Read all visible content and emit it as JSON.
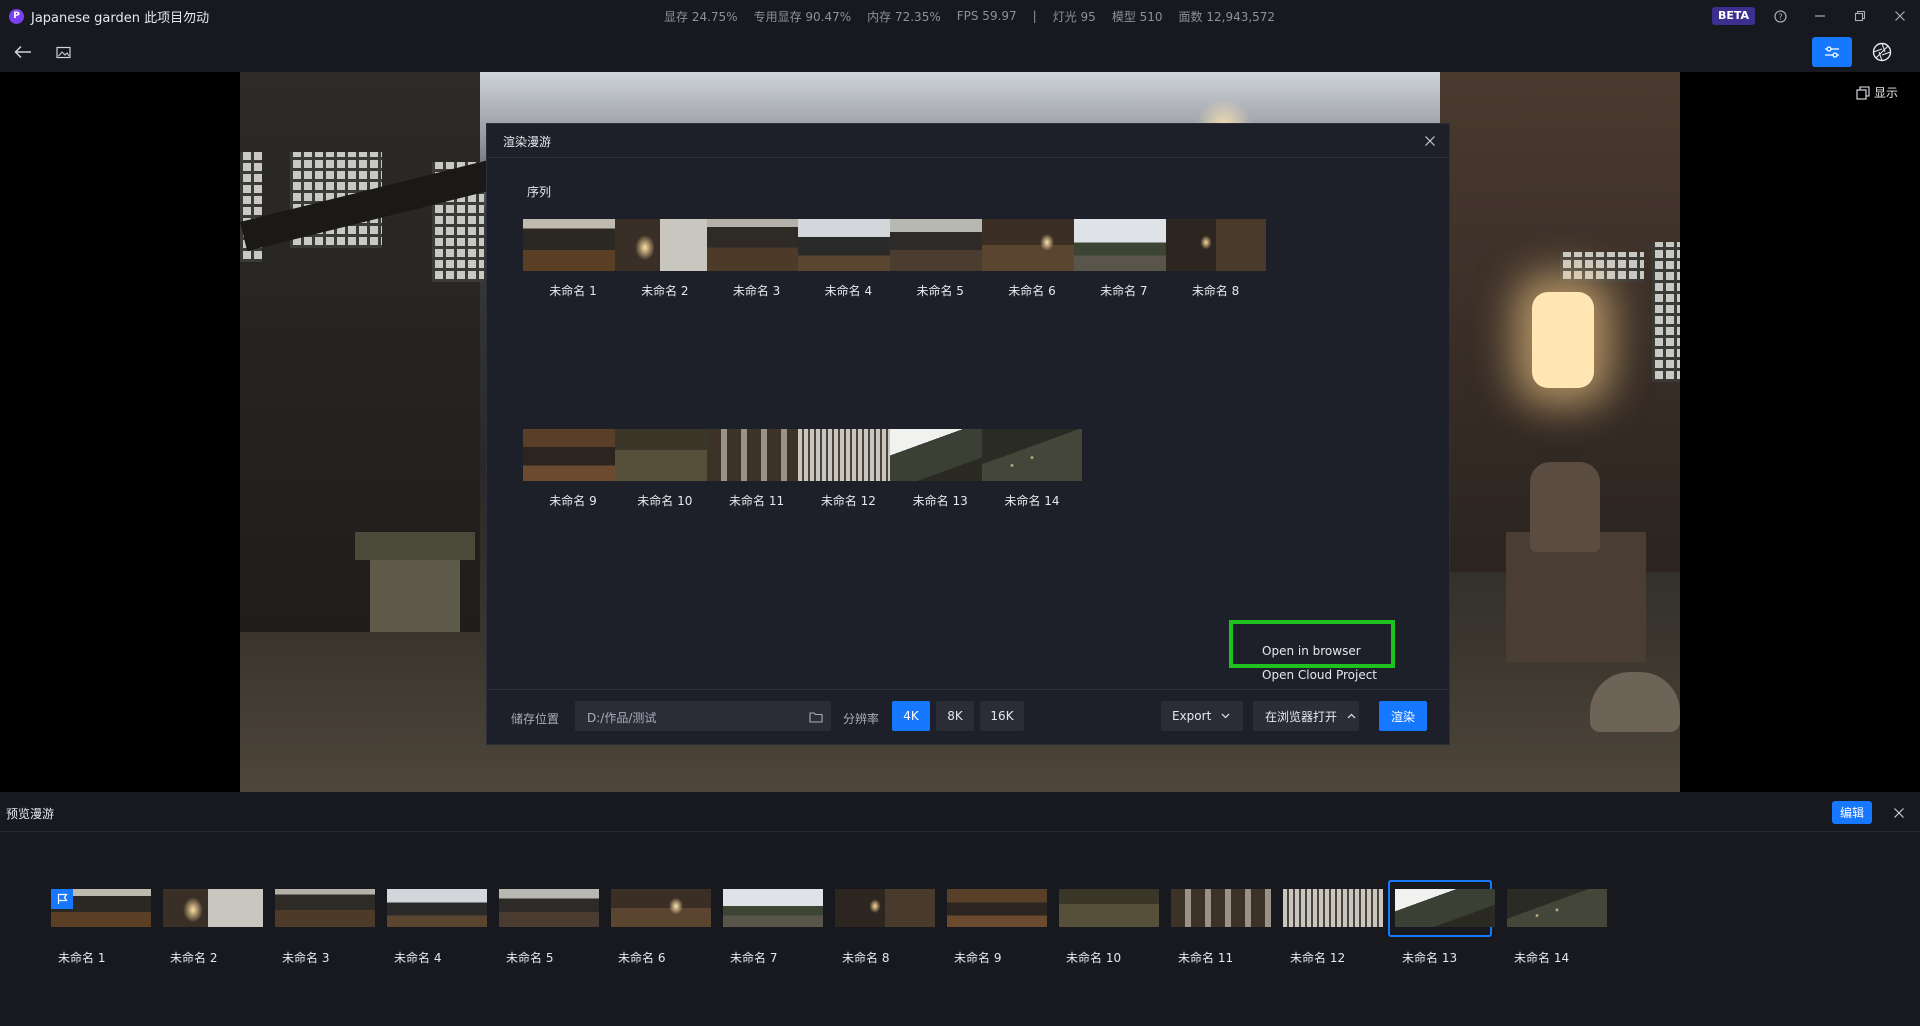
{
  "app": {
    "logo_letter": "P",
    "project_name": "Japanese garden 此项目勿动"
  },
  "stats": {
    "vram": "显存 24.75%",
    "dedicated_vram": "专用显存 90.47%",
    "memory": "内存 72.35%",
    "fps": "FPS 59.97",
    "separator": "|",
    "lights": "灯光 95",
    "models": "模型 510",
    "faces": "面数 12,943,572"
  },
  "title_bar": {
    "beta_label": "BETA",
    "icons": [
      "help-icon",
      "minimize-icon",
      "restore-icon",
      "close-icon"
    ]
  },
  "toolbar": {
    "icons": [
      "back-arrow-icon",
      "image-icon",
      "sliders-icon",
      "aperture-icon"
    ]
  },
  "viewport": {
    "display_label": "显示"
  },
  "render_dialog": {
    "title": "渲染漫游",
    "section_label": "序列",
    "sequences": [
      {
        "name": "未命名 1"
      },
      {
        "name": "未命名 2"
      },
      {
        "name": "未命名 3"
      },
      {
        "name": "未命名 4"
      },
      {
        "name": "未命名 5"
      },
      {
        "name": "未命名 6"
      },
      {
        "name": "未命名 7"
      },
      {
        "name": "未命名 8"
      },
      {
        "name": "未命名 9"
      },
      {
        "name": "未命名 10"
      },
      {
        "name": "未命名 11"
      },
      {
        "name": "未命名 12"
      },
      {
        "name": "未命名 13"
      },
      {
        "name": "未命名 14"
      }
    ],
    "storage_label": "储存位置",
    "storage_path": "D:/作品/测试",
    "resolution_label": "分辨率",
    "resolutions": [
      {
        "label": "4K",
        "selected": true
      },
      {
        "label": "8K",
        "selected": false
      },
      {
        "label": "16K",
        "selected": false
      }
    ],
    "export_label": "Export",
    "open_label": "在浏览器打开",
    "render_label": "渲染",
    "open_menu": [
      "Open in browser",
      "Open Cloud Project"
    ]
  },
  "preview_panel": {
    "title": "预览漫游",
    "edit_label": "编辑",
    "selected_index": 12,
    "items": [
      {
        "name": "未命名 1"
      },
      {
        "name": "未命名 2"
      },
      {
        "name": "未命名 3"
      },
      {
        "name": "未命名 4"
      },
      {
        "name": "未命名 5"
      },
      {
        "name": "未命名 6"
      },
      {
        "name": "未命名 7"
      },
      {
        "name": "未命名 8"
      },
      {
        "name": "未命名 9"
      },
      {
        "name": "未命名 10"
      },
      {
        "name": "未命名 11"
      },
      {
        "name": "未命名 12"
      },
      {
        "name": "未命名 13"
      },
      {
        "name": "未命名 14"
      }
    ]
  },
  "colors": {
    "accent": "#1677ff",
    "highlight": "#1ec21e",
    "beta": "#3d2f8f",
    "logo": "#7b3ff2"
  }
}
